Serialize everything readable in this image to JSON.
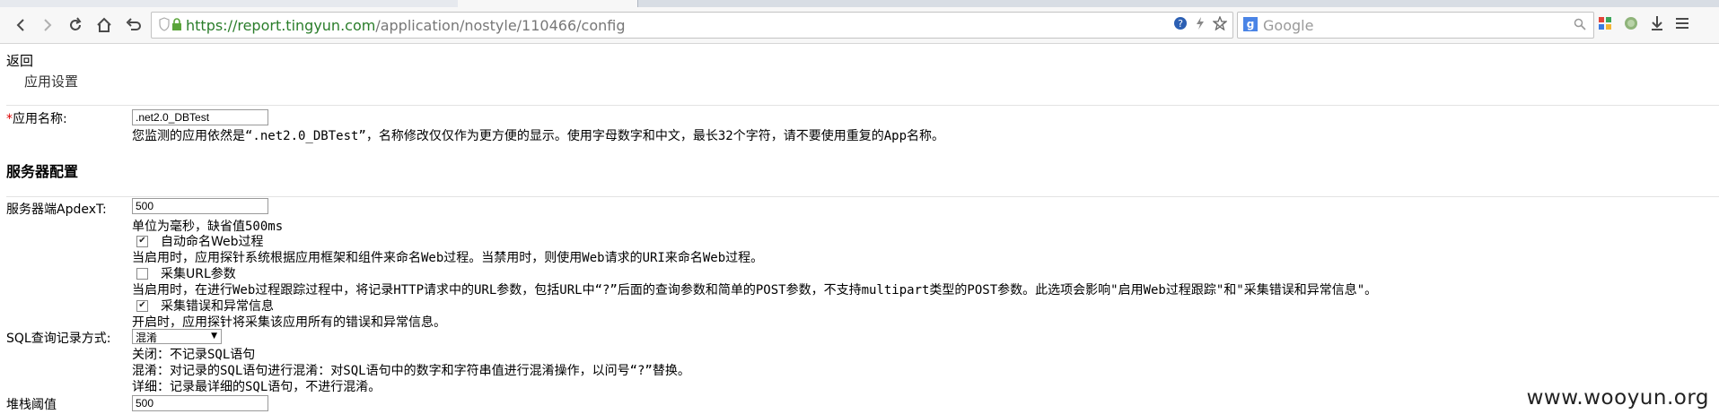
{
  "browser": {
    "url_host": "https://report.tingyun.com",
    "url_path": "/application/nostyle/110466/config",
    "search_placeholder": "Google"
  },
  "page": {
    "back_label": "返回",
    "breadcrumb": "应用设置"
  },
  "app_name": {
    "required_mark": "*",
    "label": "应用名称:",
    "value": ".net2.0_DBTest",
    "help": "您监测的应用依然是“.net2.0_DBTest”，名称修改仅仅作为更方便的显示。使用字母数字和中文，最长32个字符，请不要使用重复的App名称。"
  },
  "server_config": {
    "title": "服务器配置",
    "apdex_label": "服务器端ApdexT:",
    "apdex_value": "500",
    "apdex_help": "单位为毫秒，缺省值500ms",
    "auto_name": {
      "label": "自动命名Web过程",
      "checked": true,
      "help": "当启用时，应用探针系统根据应用框架和组件来命名Web过程。当禁用时，则使用Web请求的URI来命名Web过程。"
    },
    "collect_url": {
      "label": "采集URL参数",
      "checked": false,
      "help": "当启用时，在进行Web过程跟踪过程中，将记录HTTP请求中的URL参数，包括URL中“?”后面的查询参数和简单的POST参数，不支持multipart类型的POST参数。此选项会影响\"启用Web过程跟踪\"和\"采集错误和异常信息\"。"
    },
    "collect_errors": {
      "label": "采集错误和异常信息",
      "checked": true,
      "help": "开启时，应用探针将采集该应用所有的错误和异常信息。"
    },
    "sql_label": "SQL查询记录方式:",
    "sql_selected": "混淆",
    "sql_help_off": "关闭：不记录SQL语句",
    "sql_help_obfuscate": "混淆：对记录的SQL语句进行混淆：对SQL语句中的数字和字符串值进行混淆操作，以问号“?”替换。",
    "sql_help_detail": "详细：记录最详细的SQL语句，不进行混淆。",
    "stack_label": "堆栈阈值",
    "stack_value": "500"
  },
  "watermark": "www.wooyun.org"
}
